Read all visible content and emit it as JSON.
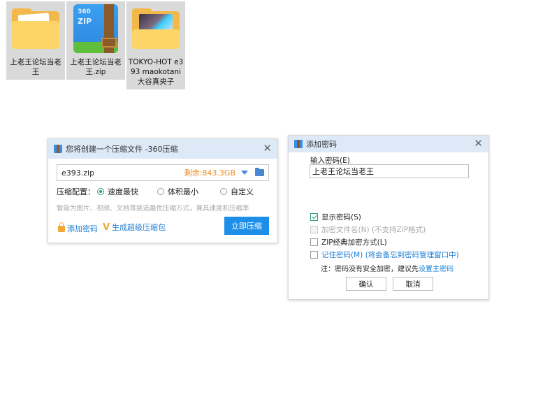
{
  "desktop": {
    "items": [
      {
        "name": "上老王论坛当老王",
        "icon": "folder-icon"
      },
      {
        "name": "上老王论坛当老王.zip",
        "icon": "zip-archive-icon",
        "icon_text": [
          "360",
          "ZIP"
        ]
      },
      {
        "name": "TOKYO-HOT e393 maokotani 大谷真央子",
        "icon": "folder-with-photo-icon"
      }
    ]
  },
  "compress_dialog": {
    "title": "您将创建一个压缩文件 -360压缩",
    "filename": "e393.zip",
    "free_space": "剩余:843.3GB",
    "config_label": "压缩配置：",
    "options": [
      "速度最快",
      "体积最小",
      "自定义"
    ],
    "selected_option": "速度最快",
    "hint": "智能为图片、视频、文档等挑选最优压缩方式，兼具速度和压缩率",
    "add_password": "添加密码",
    "super_compress": "生成超级压缩包",
    "compress_now": "立即压缩",
    "colors": {
      "primary": "#1e8fe8",
      "accent": "#f08a1c",
      "selected": "#2f9e6e"
    }
  },
  "password_dialog": {
    "title": "添加密码",
    "input_label": "输入密码(E)",
    "password_value": "上老王论坛当老王",
    "options": [
      {
        "label": "显示密码(S)",
        "checked": true,
        "disabled": false
      },
      {
        "label": "加密文件名(N) (不支持ZIP格式)",
        "checked": false,
        "disabled": true
      },
      {
        "label": "ZIP经典加密方式(L)",
        "checked": false,
        "disabled": false
      },
      {
        "label": "记住密码(M) (将会备忘到密码管理窗口中)",
        "checked": false,
        "disabled": false
      }
    ],
    "note_prefix": "注：密码没有安全加密，建议先",
    "note_link": "设置主密码",
    "ok": "确认",
    "cancel": "取消"
  }
}
